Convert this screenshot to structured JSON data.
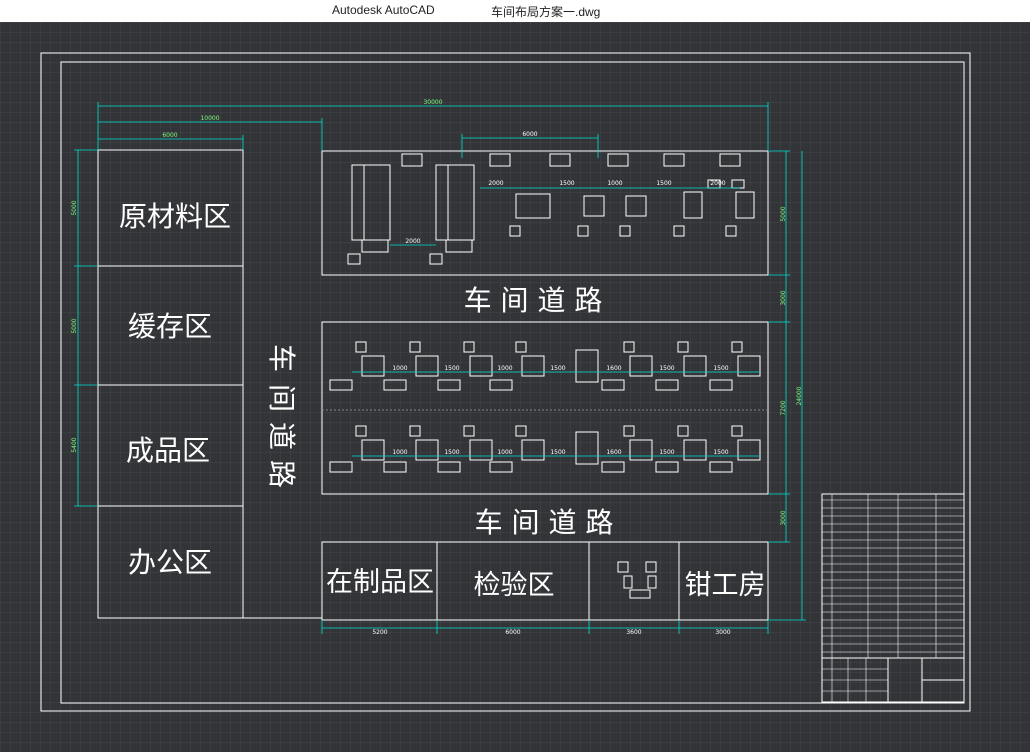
{
  "window": {
    "app_title": "Autodesk AutoCAD",
    "file_name": "车间布局方案一.dwg"
  },
  "zones": {
    "raw_material": "原材料区",
    "buffer": "缓存区",
    "finished": "成品区",
    "office": "办公区",
    "wip": "在制品区",
    "inspection": "检验区",
    "fitter": "钳工房"
  },
  "roads": {
    "horizontal": "车 间 道 路",
    "vertical": [
      "车",
      "间",
      "道",
      "路"
    ]
  },
  "dimensions": {
    "top_total": "30000",
    "top_mid": "10000",
    "top_left": "6000",
    "top_span": "6000",
    "row1": [
      "2000",
      "1500",
      "1000",
      "1500",
      "2000"
    ],
    "row1_gap": "2000",
    "row2": [
      "1000",
      "1500",
      "1000",
      "1500",
      "1600",
      "1500",
      "1500"
    ],
    "row3": [
      "1000",
      "1500",
      "1000",
      "1500",
      "1600",
      "1500",
      "1500"
    ],
    "bottom": [
      "5200",
      "6000",
      "3600",
      "3000"
    ],
    "left": [
      "5000",
      "5000",
      "5400"
    ],
    "right": [
      "5000",
      "3000",
      "7200",
      "3000"
    ],
    "right_total": "24000"
  },
  "colors": {
    "background": "#333438",
    "lines": "#ffffff",
    "dimension": "#00e0d0",
    "dimtext": "#7dff7d"
  }
}
